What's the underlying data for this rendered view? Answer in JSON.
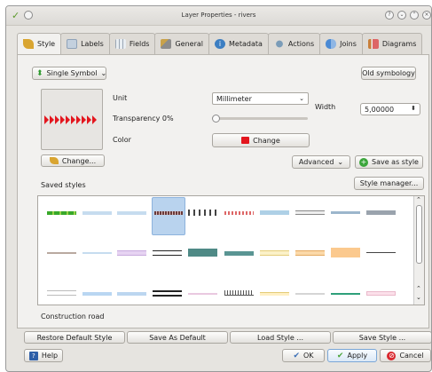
{
  "window": {
    "title": "Layer Properties - rivers"
  },
  "tabs": [
    {
      "label": "Style",
      "icon": "paintbrush-icon",
      "color": "#d9a531"
    },
    {
      "label": "Labels",
      "icon": "labels-icon",
      "color": "#a7b7c9"
    },
    {
      "label": "Fields",
      "icon": "table-icon",
      "color": "#9aa6b4"
    },
    {
      "label": "General",
      "icon": "tools-icon",
      "color": "#c9a24a"
    },
    {
      "label": "Metadata",
      "icon": "info-icon",
      "color": "#3c7ec2"
    },
    {
      "label": "Actions",
      "icon": "gears-icon",
      "color": "#7b9cb8"
    },
    {
      "label": "Joins",
      "icon": "join-icon",
      "color": "#4b8ad4"
    },
    {
      "label": "Diagrams",
      "icon": "diagram-icon",
      "color": "#c97f3a"
    }
  ],
  "style": {
    "renderer": "Single Symbol",
    "old_symbology": "Old symbology",
    "unit_label": "Unit",
    "unit_value": "Millimeter",
    "width_label": "Width",
    "width_value": "5,00000",
    "transparency_label": "Transparency 0%",
    "transparency": 0,
    "color_label": "Color",
    "color_button": "Change",
    "symbol_color": "#e3161e",
    "change_button": "Change...",
    "advanced_button": "Advanced",
    "save_as_style": "Save as style",
    "saved_styles_label": "Saved styles",
    "style_manager": "Style manager...",
    "selected_style": "Construction road"
  },
  "bottom": {
    "restore": "Restore Default Style",
    "save_default": "Save As Default",
    "load": "Load Style ...",
    "save_style": "Save Style ...",
    "help": "Help",
    "ok": "OK",
    "apply": "Apply",
    "cancel": "Cancel"
  }
}
